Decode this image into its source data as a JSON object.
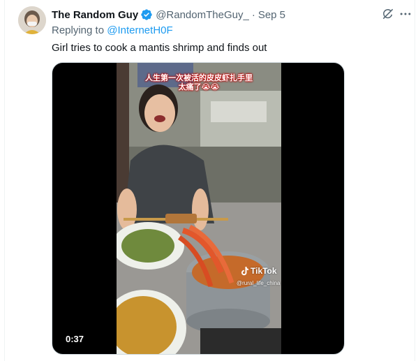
{
  "tweet": {
    "display_name": "The Random Guy",
    "handle": "@RandomTheGuy_",
    "separator": "·",
    "time": "Sep 5",
    "replying_prefix": "Replying to ",
    "replying_to": "@InternetH0F",
    "text": "Girl tries to cook a mantis shrimp and finds out"
  },
  "media": {
    "caption_line1": "人生第一次被活的皮皮虾扎手里",
    "caption_line2": "太痛了😭😭",
    "tiktok_label": "TikTok",
    "tiktok_user": "@rural_life_china",
    "duration": "0:37"
  },
  "icons": {
    "verified": "verified-badge-icon",
    "grok": "grok-icon",
    "more": "more-icon"
  },
  "colors": {
    "accent": "#1d9bf0",
    "text": "#0f1419",
    "secondary": "#536471"
  }
}
